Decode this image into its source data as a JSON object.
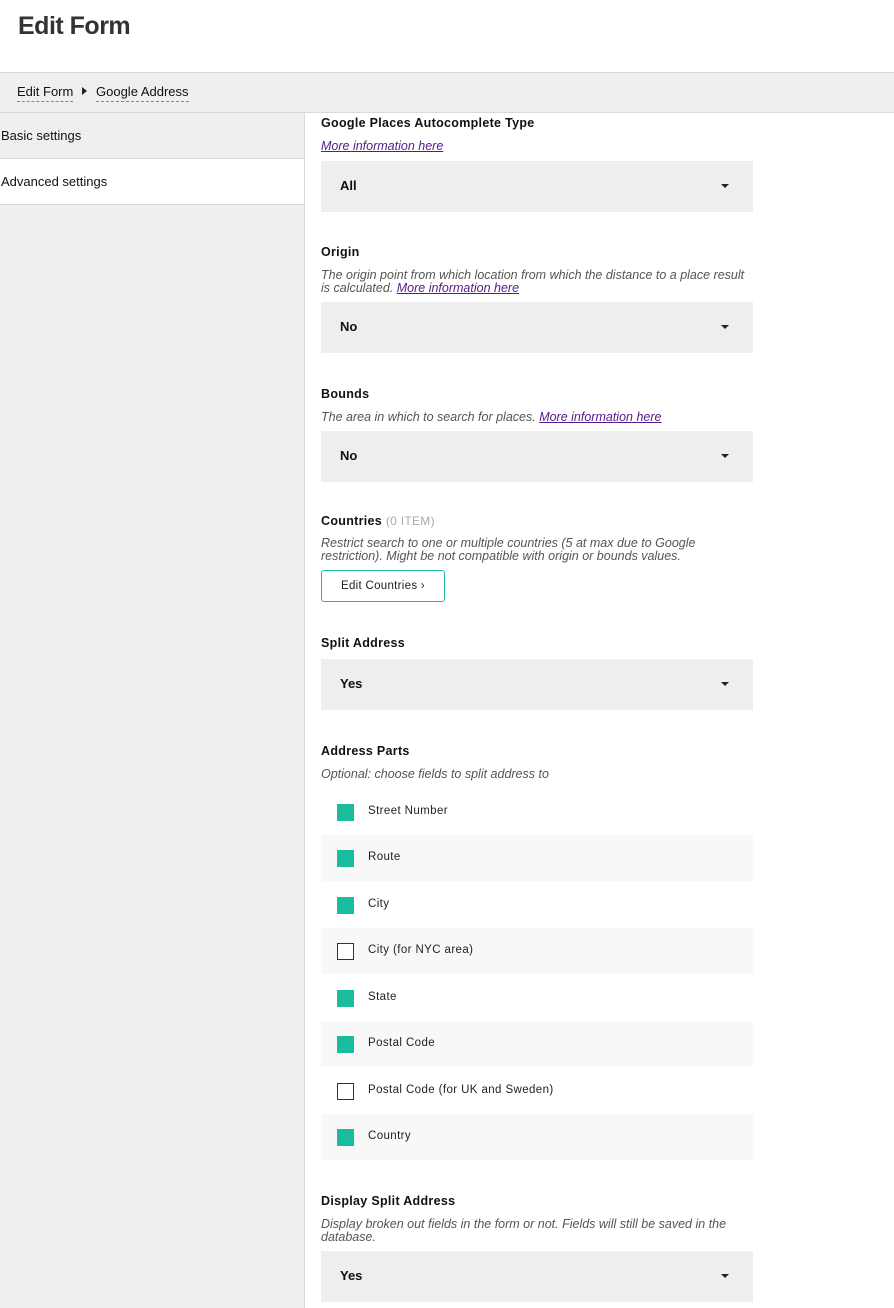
{
  "header": {
    "title": "Edit Form"
  },
  "breadcrumb": {
    "items": [
      "Edit Form",
      "Google Address"
    ]
  },
  "sidebar": {
    "items": [
      {
        "label": "Basic settings"
      },
      {
        "label": "Advanced settings"
      }
    ]
  },
  "fields": {
    "autocomplete_type": {
      "label": "Google Places Autocomplete Type",
      "link": "More information here",
      "value": "All"
    },
    "origin": {
      "label": "Origin",
      "desc": "The origin point from which location from which the distance to a place result is calculated.",
      "link": "More information here",
      "value": "No"
    },
    "bounds": {
      "label": "Bounds",
      "desc": "The area in which to search for places.",
      "link": "More information here",
      "value": "No"
    },
    "countries": {
      "label": "Countries",
      "count": "(0 ITEM)",
      "desc": "Restrict search to one or multiple countries (5 at max due to Google restriction). Might be not compatible with origin or bounds values.",
      "button": "Edit Countries ›"
    },
    "split_address": {
      "label": "Split Address",
      "value": "Yes"
    },
    "address_parts": {
      "label": "Address Parts",
      "desc": "Optional: choose fields to split address to",
      "options": [
        {
          "label": "Street Number",
          "checked": true
        },
        {
          "label": "Route",
          "checked": true
        },
        {
          "label": "City",
          "checked": true
        },
        {
          "label": "City (for NYC area)",
          "checked": false
        },
        {
          "label": "State",
          "checked": true
        },
        {
          "label": "Postal Code",
          "checked": true
        },
        {
          "label": "Postal Code (for UK and Sweden)",
          "checked": false
        },
        {
          "label": "Country",
          "checked": true
        }
      ]
    },
    "display_split_address": {
      "label": "Display Split Address",
      "desc": "Display broken out fields in the form or not. Fields will still be saved in the database.",
      "value": "Yes"
    }
  },
  "colors": {
    "accent": "#1abc9c",
    "select_bg": "#eeeeee",
    "link": "#551a8b"
  }
}
